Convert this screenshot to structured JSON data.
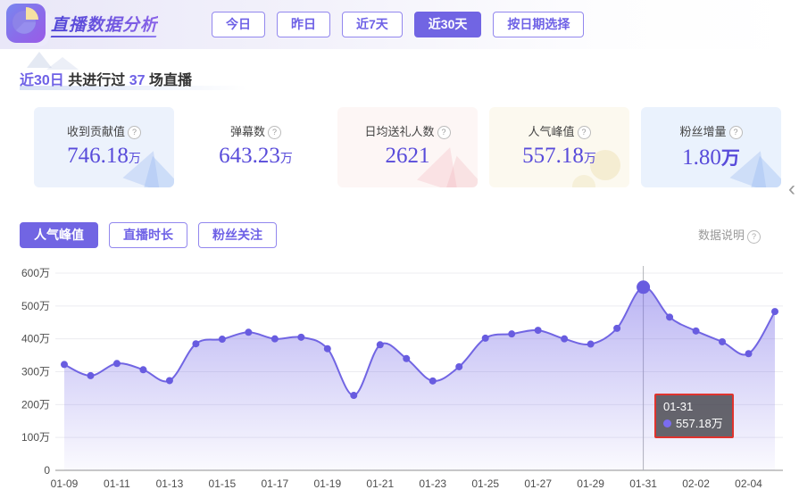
{
  "colors": {
    "accent": "#7165e3",
    "value_text": "#584bda",
    "line": "#7165e3",
    "dot": "#685ce0",
    "tooltip_border": "#df332e",
    "grid": "#ececf0",
    "axis": "#909090"
  },
  "header": {
    "title": "直播数据分析",
    "logo_icon": "pie-chart-icon",
    "periods": [
      {
        "label": "今日",
        "active": false
      },
      {
        "label": "昨日",
        "active": false
      },
      {
        "label": "近7天",
        "active": false
      },
      {
        "label": "近30天",
        "active": true
      },
      {
        "label": "按日期选择",
        "active": false
      }
    ]
  },
  "summary": {
    "range": "近30日",
    "middle": "共进行过",
    "count": "37",
    "suffix": "场直播"
  },
  "cards": {
    "items": [
      {
        "label": "收到贡献值",
        "help_icon": "?",
        "value": "746.18",
        "unit": "万",
        "bg": "#ecf2fc",
        "decor": "decor-blue"
      },
      {
        "label": "弹幕数",
        "help_icon": "?",
        "value": "643.23",
        "unit": "万",
        "bg": "#ffffff",
        "decor": ""
      },
      {
        "label": "日均送礼人数",
        "help_icon": "?",
        "value": "2621",
        "unit": "",
        "bg": "#fdf6f5",
        "decor": "decor-pink"
      },
      {
        "label": "人气峰值",
        "help_icon": "?",
        "value": "557.18",
        "unit": "万",
        "bg": "#fcf9ef",
        "decor": "decor-cream"
      },
      {
        "label": "粉丝增量",
        "help_icon": "?",
        "value": "1.80",
        "unit": "万",
        "unit_large": true,
        "bg": "#eaf2fd",
        "decor": "decor-blue"
      }
    ]
  },
  "tabs": {
    "items": [
      {
        "label": "人气峰值",
        "active": true
      },
      {
        "label": "直播时长",
        "active": false
      },
      {
        "label": "粉丝关注",
        "active": false
      }
    ],
    "data_note": "数据说明",
    "data_note_icon": "?"
  },
  "tooltip": {
    "date": "01-31",
    "value": "557.18万"
  },
  "chart_data": {
    "type": "area",
    "title": "人气峰值 (近30天)",
    "unit": "万",
    "x": [
      "01-09",
      "01-10",
      "01-11",
      "01-12",
      "01-13",
      "01-14",
      "01-15",
      "01-16",
      "01-17",
      "01-18",
      "01-19",
      "01-20",
      "01-21",
      "01-22",
      "01-23",
      "01-24",
      "01-25",
      "01-26",
      "01-27",
      "01-28",
      "01-29",
      "01-30",
      "01-31",
      "02-01",
      "02-02",
      "02-03",
      "02-04",
      "02-05"
    ],
    "values": [
      322,
      288,
      325,
      306,
      273,
      385,
      399,
      420,
      400,
      405,
      370,
      228,
      382,
      340,
      272,
      315,
      402,
      415,
      426,
      400,
      384,
      432,
      557.18,
      466,
      424,
      391,
      355,
      483
    ],
    "x_label_every": 2,
    "y_ticks": [
      0,
      100,
      200,
      300,
      400,
      500,
      600
    ],
    "y_tick_labels": [
      "0",
      "100万",
      "200万",
      "300万",
      "400万",
      "500万",
      "600万"
    ],
    "ylim": [
      0,
      600
    ],
    "grid": true,
    "legend": "none",
    "highlight_index": 22,
    "highlight_label": "01-31",
    "highlight_value": "557.18万"
  }
}
